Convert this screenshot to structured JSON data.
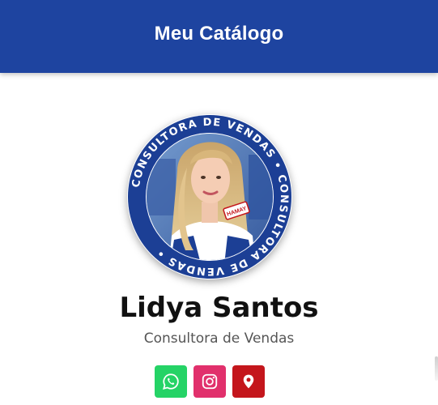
{
  "header": {
    "title": "Meu Catálogo",
    "background": "#1e44a0"
  },
  "profile": {
    "name": "Lidya Santos",
    "role": "Consultora de Vendas",
    "photo": {
      "ring_text": "CONSULTORA DE VENDAS • CONSULTORA DE VENDAS •",
      "ring_color": "#1c3f95",
      "shirt_badge": "HAMAY"
    }
  },
  "socials": [
    {
      "name": "whatsapp",
      "icon": "whatsapp-icon",
      "color": "#25d366"
    },
    {
      "name": "instagram",
      "icon": "instagram-icon",
      "color": "#e1306c"
    },
    {
      "name": "location",
      "icon": "map-pin-icon",
      "color": "#c4161c"
    }
  ]
}
